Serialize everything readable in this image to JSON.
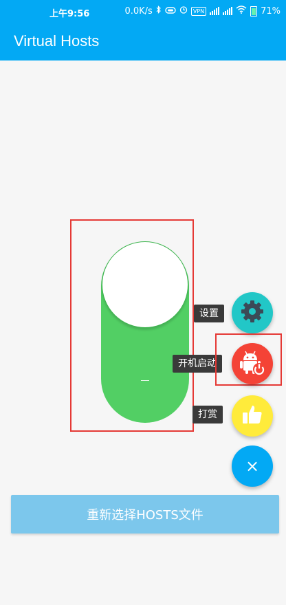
{
  "status_bar": {
    "time": "上午9:56",
    "net_speed": "0.0K/s",
    "vpn": "VPN",
    "battery": "71%",
    "icons": [
      "bluetooth-icon",
      "cast-icon",
      "alarm-icon",
      "vpn-icon",
      "signal-icon",
      "signal-icon",
      "wifi-icon",
      "battery-icon"
    ]
  },
  "app_bar": {
    "title": "Virtual Hosts"
  },
  "main_toggle": {
    "state": "on",
    "color": "#52cf64"
  },
  "fab_menu": {
    "settings": {
      "label": "设置",
      "icon": "gear-icon",
      "color": "#22c7c7"
    },
    "boot_start": {
      "label": "开机启动",
      "icon": "android-power-icon",
      "color": "#f44336"
    },
    "reward": {
      "label": "打赏",
      "icon": "thumbs-up-icon",
      "color": "#ffeb3b"
    },
    "close": {
      "glyph": "×",
      "icon": "close-icon",
      "color": "#03a9f4"
    }
  },
  "bottom_button": {
    "label": "重新选择HOSTS文件",
    "color": "#7cc7ec"
  },
  "accent_color": "#03a9f4"
}
